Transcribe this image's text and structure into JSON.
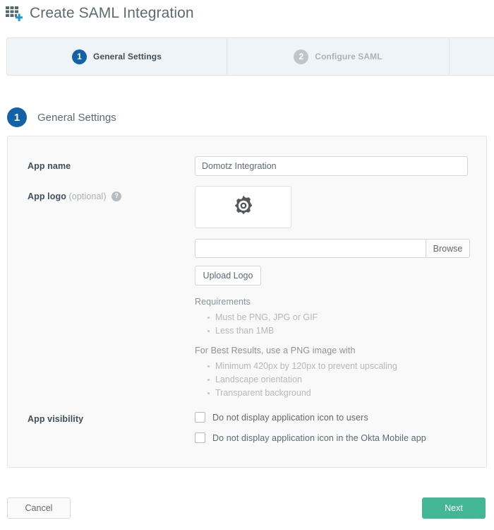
{
  "header": {
    "title": "Create SAML Integration",
    "icon": "app-grid-plus-icon"
  },
  "stepper": {
    "steps": [
      {
        "number": "1",
        "label": "General Settings",
        "state": "active"
      },
      {
        "number": "2",
        "label": "Configure SAML",
        "state": "inactive"
      }
    ]
  },
  "section": {
    "number": "1",
    "title": "General Settings"
  },
  "form": {
    "app_name": {
      "label": "App name",
      "value": "Domotz Integration",
      "placeholder": ""
    },
    "app_logo": {
      "label": "App logo",
      "optional_text": "(optional)",
      "help_glyph": "?",
      "preview_icon": "gear-icon",
      "file_path_value": "",
      "file_path_placeholder": "",
      "browse_label": "Browse",
      "upload_label": "Upload Logo"
    },
    "requirements": {
      "heading": "Requirements",
      "items": [
        "Must be PNG, JPG or GIF",
        "Less than 1MB"
      ],
      "best_results_heading": "For Best Results, use a PNG image with",
      "best_results_items": [
        "Minimum 420px by 120px to prevent upscaling",
        "Landscape orientation",
        "Transparent background"
      ]
    },
    "app_visibility": {
      "label": "App visibility",
      "options": [
        {
          "label": "Do not display application icon to users",
          "checked": false
        },
        {
          "label": "Do not display application icon in the Okta Mobile app",
          "checked": false
        }
      ]
    }
  },
  "footer": {
    "cancel_label": "Cancel",
    "next_label": "Next"
  },
  "colors": {
    "accent_blue": "#1262a8",
    "primary_green": "#43b795",
    "stepper_bg": "#eff4f8",
    "panel_bg": "#f9f9f9",
    "text_dark": "#3f4f5a",
    "text_muted": "#b3b9bd"
  }
}
